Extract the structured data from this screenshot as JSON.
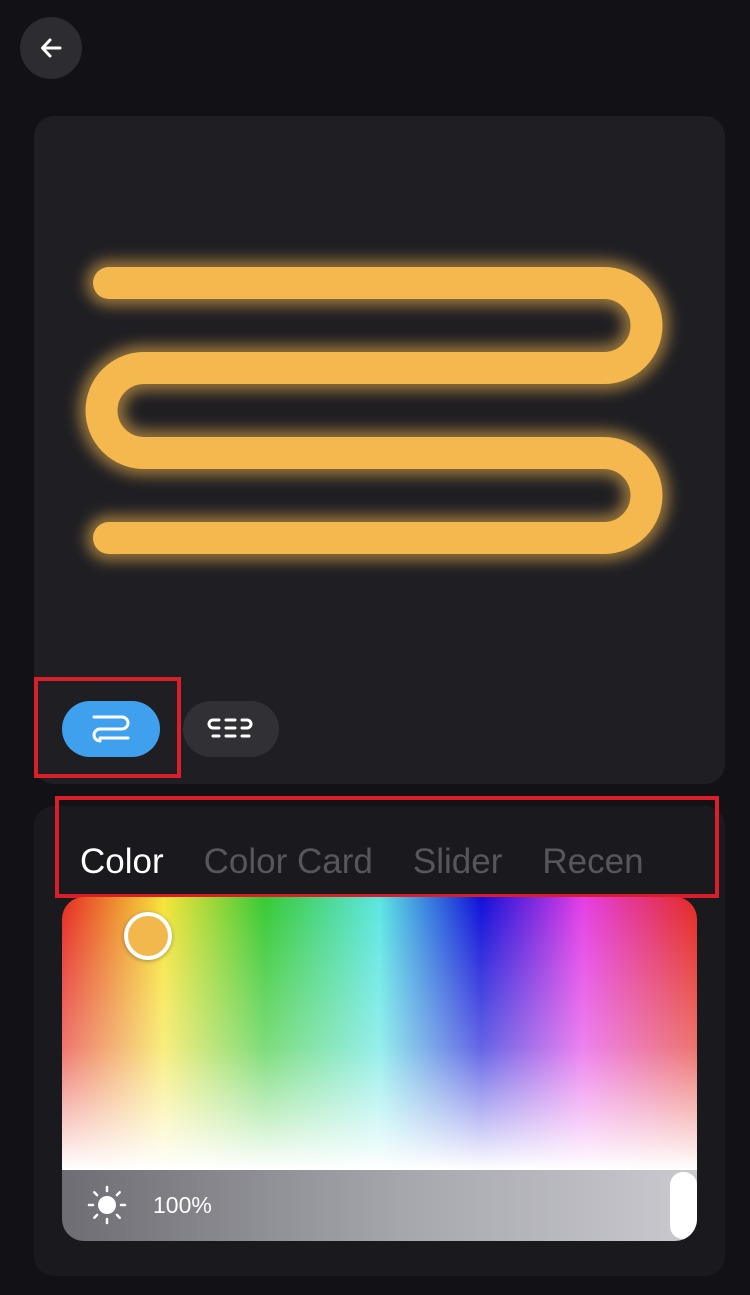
{
  "header": {
    "back_icon": "arrow-left-icon"
  },
  "preview": {
    "strip_color": "#f5b84f",
    "background": "#1f1f23"
  },
  "modes": [
    {
      "icon": "strip-loop-icon",
      "active": true,
      "color": "#3fa1ee"
    },
    {
      "icon": "segmented-strip-icon",
      "active": false
    }
  ],
  "tabs": [
    {
      "label": "Color",
      "active": true
    },
    {
      "label": "Color Card",
      "active": false
    },
    {
      "label": "Slider",
      "active": false
    },
    {
      "label": "Recen",
      "active": false
    }
  ],
  "picker": {
    "selected_color": "#f3b84d",
    "brightness_icon": "sun-icon",
    "brightness_label": "100%",
    "brightness_percent": 100
  }
}
